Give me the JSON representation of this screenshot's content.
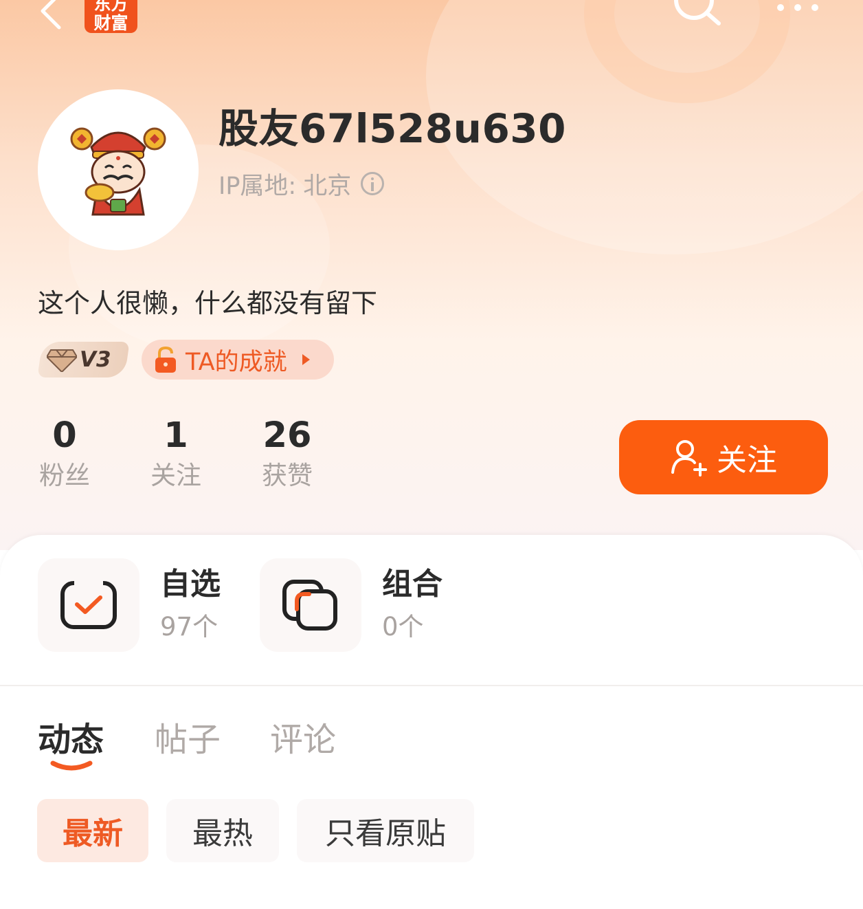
{
  "topbar": {
    "logo_line1": "东方",
    "logo_line2": "财富",
    "back_icon": "chevron-left-icon",
    "search_icon": "search-icon",
    "more_icon": "more-dots-icon"
  },
  "profile": {
    "username": "股友67l528u630",
    "ip_label": "IP属地:",
    "ip_location": "北京",
    "bio": "这个人很懒，什么都没有留下",
    "level_badge": "V3",
    "achievement_label": "TA的成就"
  },
  "stats": [
    {
      "value": "0",
      "label": "粉丝"
    },
    {
      "value": "1",
      "label": "关注"
    },
    {
      "value": "26",
      "label": "获赞"
    }
  ],
  "follow_button": "关注",
  "assets": [
    {
      "title": "自选",
      "count": "97个"
    },
    {
      "title": "组合",
      "count": "0个"
    }
  ],
  "tabs": [
    "动态",
    "帖子",
    "评论"
  ],
  "filters": [
    "最新",
    "最热",
    "只看原贴"
  ],
  "colors": {
    "accent": "#fc5d0f",
    "accent_text": "#ee5a24"
  }
}
